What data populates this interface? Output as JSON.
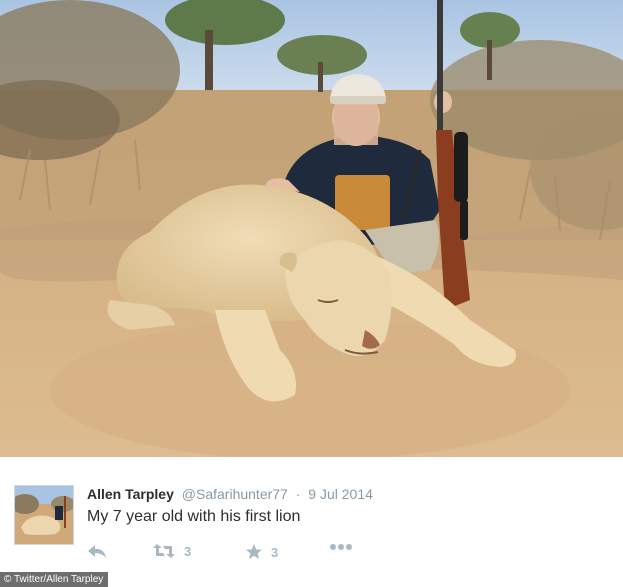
{
  "photo": {
    "description_icon": "hunting-photo"
  },
  "tweet": {
    "author_name": "Allen Tarpley",
    "handle": "@Safarihunter77",
    "separator": "·",
    "date": "9 Jul 2014",
    "text": "My 7 year old with his first lion",
    "actions": {
      "reply_icon": "reply-icon",
      "retweet_icon": "retweet-icon",
      "retweet_count": "3",
      "favorite_icon": "star-icon",
      "favorite_count": "3",
      "more_icon": "more-icon"
    }
  },
  "credit": "© Twitter/Allen Tarpley",
  "colors": {
    "name": "#292f33",
    "meta": "#8899a6",
    "action": "#aab8c2",
    "sky": "#b9cfe6",
    "sand": "#d9b98c"
  }
}
